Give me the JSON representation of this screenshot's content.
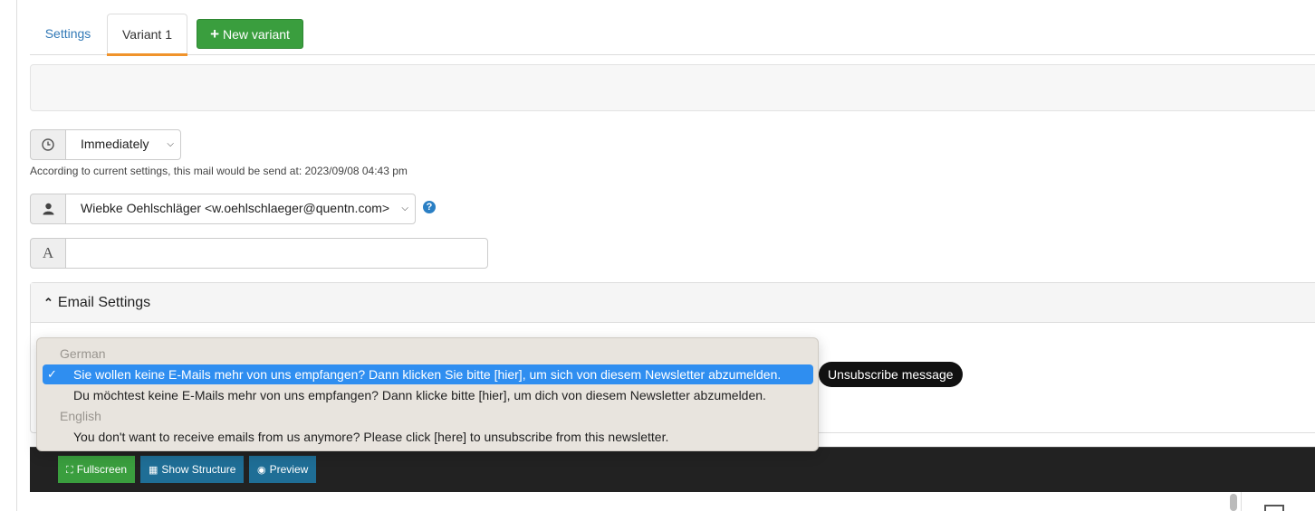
{
  "tabs": {
    "settings_label": "Settings",
    "variant_label": "Variant 1",
    "new_variant_label": "New variant"
  },
  "schedule": {
    "selected": "Immediately",
    "hint": "According to current settings, this mail would be send at: 2023/09/08 04:43 pm"
  },
  "sender": {
    "selected": "Wiebke Oehlschläger <w.oehlschlaeger@quentn.com>"
  },
  "subject": {
    "icon_glyph": "A",
    "value": ""
  },
  "email_settings": {
    "title": "Email Settings"
  },
  "unsubscribe_dropdown": {
    "group_german": "German",
    "options_german": [
      "Sie wollen keine E-Mails mehr von uns empfangen? Dann klicken Sie bitte [hier], um sich von diesem Newsletter abzumelden.",
      "Du möchtest keine E-Mails mehr von uns empfangen? Dann klicke bitte [hier], um dich von diesem Newsletter abzumelden."
    ],
    "group_english": "English",
    "options_english": [
      "You don't want to receive emails from us anymore? Please click [here] to unsubscribe from this newsletter."
    ],
    "selected_index": 0,
    "check_glyph": "✓"
  },
  "tooltip": "Unsubscribe message",
  "editor_toolbar": {
    "fullscreen": "Fullscreen",
    "show_structure": "Show Structure",
    "preview": "Preview"
  },
  "colors": {
    "green_button": "#3a9e3e",
    "blue_button": "#1f6e96",
    "tab_accent": "#f0932b",
    "selection": "#2f8ef0",
    "link": "#337ab7"
  }
}
